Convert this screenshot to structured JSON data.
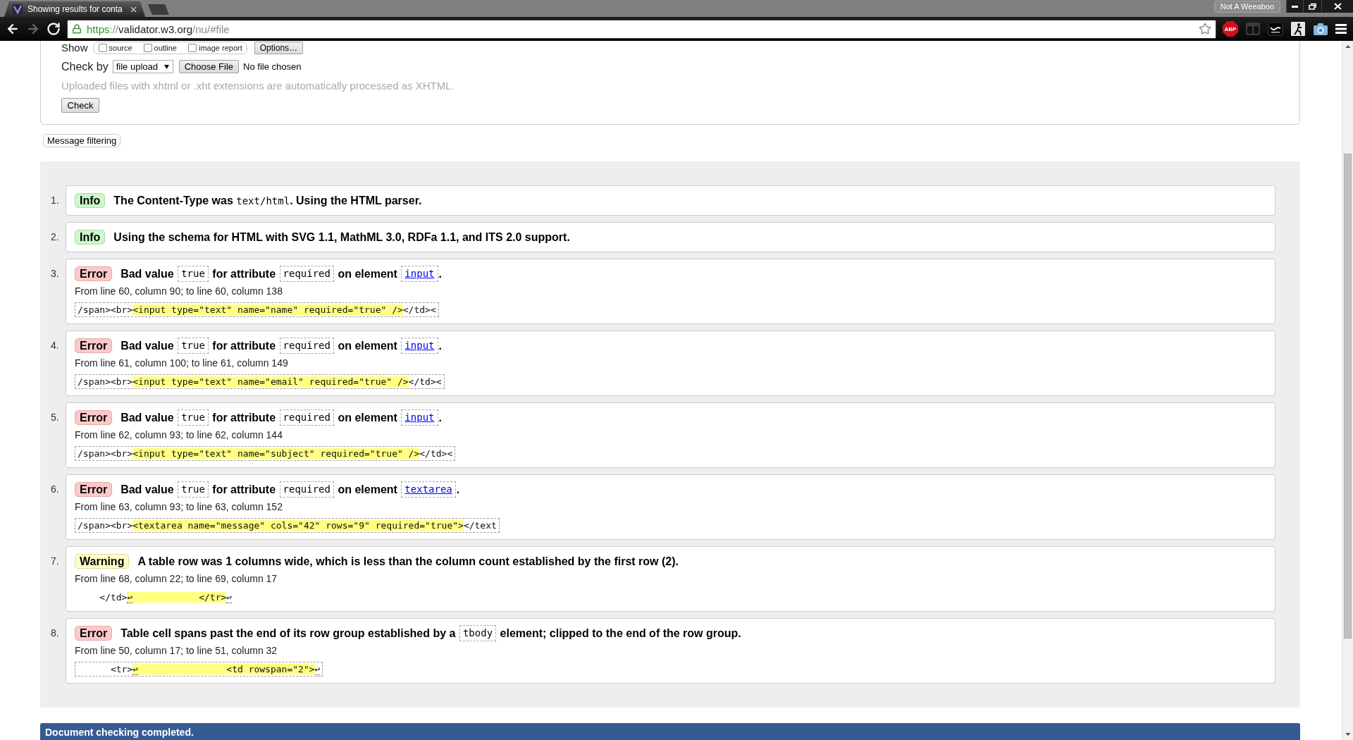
{
  "browser": {
    "tab": {
      "title": "Showing results for conta"
    },
    "profile": "Not A Weeaboo",
    "nav": [
      {
        "kind": "back",
        "disabled": false
      },
      {
        "kind": "forward",
        "disabled": true
      },
      {
        "kind": "reload",
        "disabled": false
      }
    ],
    "address": {
      "scheme": "https",
      "separator": "://",
      "host": "validator.w3.org",
      "path": "/nu/#file"
    },
    "adblock": "ABP"
  },
  "form": {
    "show": {
      "label": "Show",
      "options": [
        {
          "label": "source",
          "checked": false
        },
        {
          "label": "outline",
          "checked": false
        },
        {
          "label": "image report",
          "checked": false
        }
      ],
      "button": "Options…"
    },
    "check_by": {
      "label": "Check by",
      "select": "file upload",
      "file_button": "Choose File",
      "file_status": "No file chosen"
    },
    "hint": "Uploaded files with xhtml or .xht extensions are automatically processed as XHTML.",
    "submit": "Check"
  },
  "filter_button": "Message filtering",
  "messages": [
    {
      "number": "1.",
      "kind": "info",
      "badge": "Info",
      "text": [
        {
          "kind": "plain",
          "text": "The Content-Type was "
        },
        {
          "kind": "mono",
          "text": "text/html"
        },
        {
          "kind": "plain",
          "text": ". Using the HTML parser."
        }
      ]
    },
    {
      "number": "2.",
      "kind": "info",
      "badge": "Info",
      "text": [
        {
          "kind": "plain",
          "text": "Using the schema for HTML with SVG 1.1, MathML 3.0, RDFa 1.1, and ITS 2.0 support."
        }
      ]
    },
    {
      "number": "3.",
      "kind": "error",
      "badge": "Error",
      "text": [
        {
          "kind": "plain",
          "text": "Bad value "
        },
        {
          "kind": "code",
          "text": "true"
        },
        {
          "kind": "plain",
          "text": " for attribute "
        },
        {
          "kind": "code",
          "text": "required"
        },
        {
          "kind": "plain",
          "text": " on element "
        },
        {
          "kind": "link",
          "text": "input"
        },
        {
          "kind": "plain",
          "text": "."
        }
      ],
      "location": "From line 60, column 90; to line 60, column 138",
      "extract": {
        "framed": true,
        "parts": [
          {
            "kind": "code",
            "text": "/span><br>",
            "highlighted": false
          },
          {
            "kind": "code",
            "text": "<input type=\"text\" name=\"name\" required=\"true\" />",
            "highlighted": true
          },
          {
            "kind": "code",
            "text": "</td><",
            "highlighted": false
          }
        ]
      }
    },
    {
      "number": "4.",
      "kind": "error",
      "badge": "Error",
      "text": [
        {
          "kind": "plain",
          "text": "Bad value "
        },
        {
          "kind": "code",
          "text": "true"
        },
        {
          "kind": "plain",
          "text": " for attribute "
        },
        {
          "kind": "code",
          "text": "required"
        },
        {
          "kind": "plain",
          "text": " on element "
        },
        {
          "kind": "link",
          "text": "input"
        },
        {
          "kind": "plain",
          "text": "."
        }
      ],
      "location": "From line 61, column 100; to line 61, column 149",
      "extract": {
        "framed": true,
        "parts": [
          {
            "kind": "code",
            "text": "/span><br>",
            "highlighted": false
          },
          {
            "kind": "code",
            "text": "<input type=\"text\" name=\"email\" required=\"true\" />",
            "highlighted": true
          },
          {
            "kind": "code",
            "text": "</td><",
            "highlighted": false
          }
        ]
      }
    },
    {
      "number": "5.",
      "kind": "error",
      "badge": "Error",
      "text": [
        {
          "kind": "plain",
          "text": "Bad value "
        },
        {
          "kind": "code",
          "text": "true"
        },
        {
          "kind": "plain",
          "text": " for attribute "
        },
        {
          "kind": "code",
          "text": "required"
        },
        {
          "kind": "plain",
          "text": " on element "
        },
        {
          "kind": "link",
          "text": "input"
        },
        {
          "kind": "plain",
          "text": "."
        }
      ],
      "location": "From line 62, column 93; to line 62, column 144",
      "extract": {
        "framed": true,
        "parts": [
          {
            "kind": "code",
            "text": "/span><br>",
            "highlighted": false
          },
          {
            "kind": "code",
            "text": "<input type=\"text\" name=\"subject\" required=\"true\" />",
            "highlighted": true
          },
          {
            "kind": "code",
            "text": "</td><",
            "highlighted": false
          }
        ]
      }
    },
    {
      "number": "6.",
      "kind": "error",
      "badge": "Error",
      "text": [
        {
          "kind": "plain",
          "text": "Bad value "
        },
        {
          "kind": "code",
          "text": "true"
        },
        {
          "kind": "plain",
          "text": " for attribute "
        },
        {
          "kind": "code",
          "text": "required"
        },
        {
          "kind": "plain",
          "text": " on element "
        },
        {
          "kind": "link",
          "text": "textarea"
        },
        {
          "kind": "plain",
          "text": "."
        }
      ],
      "location": "From line 63, column 93; to line 63, column 152",
      "extract": {
        "framed": true,
        "parts": [
          {
            "kind": "code",
            "text": "/span><br>",
            "highlighted": false
          },
          {
            "kind": "code",
            "text": "<textarea name=\"message\" cols=\"42\" rows=\"9\" required=\"true\">",
            "highlighted": true
          },
          {
            "kind": "code",
            "text": "</text",
            "highlighted": false
          }
        ]
      }
    },
    {
      "number": "7.",
      "kind": "warning",
      "badge": "Warning",
      "text": [
        {
          "kind": "plain",
          "text": "A table row was 1 columns wide, which is less than the column count established by the first row (2)."
        }
      ],
      "location": "From line 68, column 22; to line 69, column 17",
      "extract": {
        "framed": false,
        "parts": [
          {
            "kind": "code",
            "text": "    </td>",
            "highlighted": false
          },
          {
            "kind": "newline",
            "text": "↩",
            "highlighted": true
          },
          {
            "kind": "code",
            "text": "            </tr>",
            "highlighted": true
          },
          {
            "kind": "newline",
            "text": "↩",
            "highlighted": false
          }
        ]
      }
    },
    {
      "number": "8.",
      "kind": "error",
      "badge": "Error",
      "text": [
        {
          "kind": "plain",
          "text": "Table cell spans past the end of its row group established by a "
        },
        {
          "kind": "code",
          "text": "tbody"
        },
        {
          "kind": "plain",
          "text": " element; clipped to the end of the row group."
        }
      ],
      "location": "From line 50, column 17; to line 51, column 32",
      "extract": {
        "framed": true,
        "parts": [
          {
            "kind": "code",
            "text": "      <tr>",
            "highlighted": false
          },
          {
            "kind": "newline",
            "text": "↩",
            "highlighted": true
          },
          {
            "kind": "code",
            "text": "                <td rowspan=\"2\">",
            "highlighted": true
          },
          {
            "kind": "newline",
            "text": "↩",
            "highlighted": false
          }
        ]
      }
    }
  ],
  "status_bar": "Document checking completed."
}
